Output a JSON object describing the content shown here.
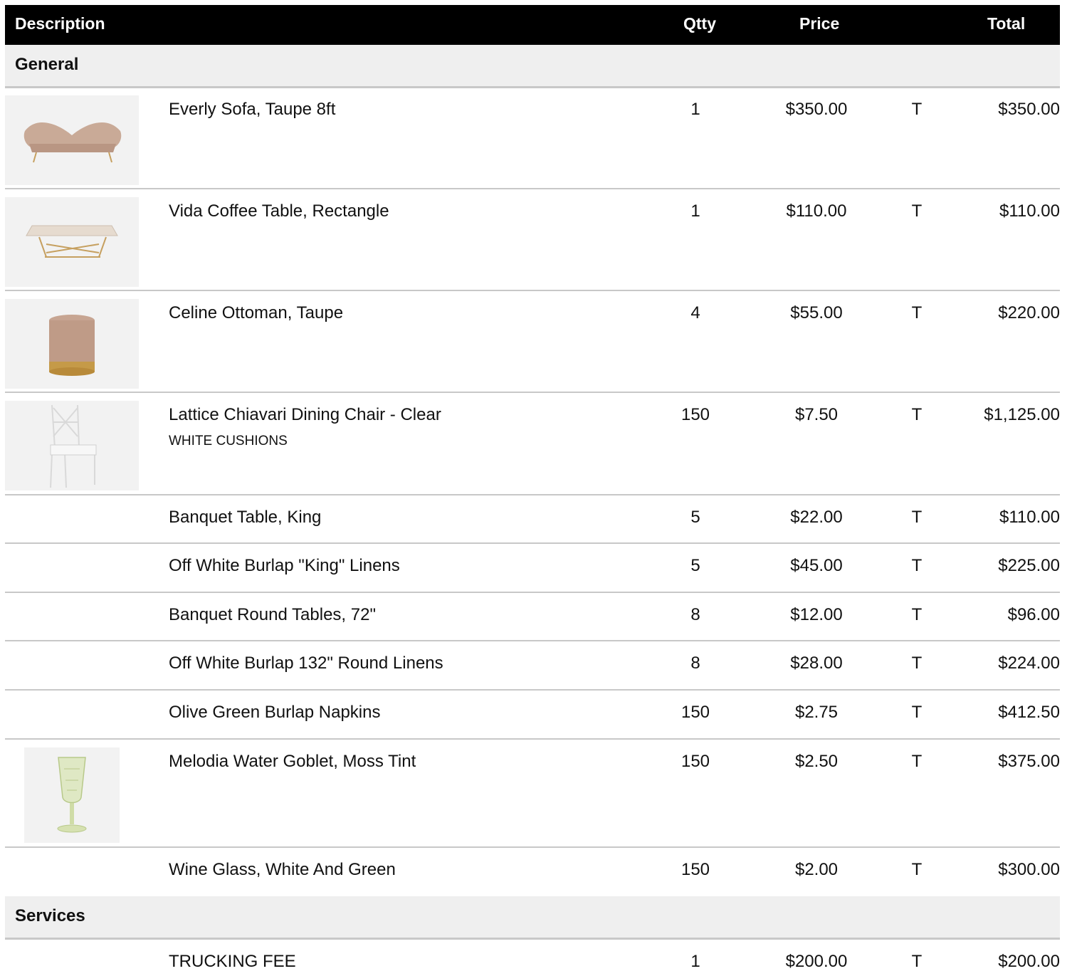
{
  "header": {
    "description": "Description",
    "qty": "Qtty",
    "price": "Price",
    "total": "Total"
  },
  "sections": [
    {
      "title": "General",
      "items": [
        {
          "description": "Everly Sofa, Taupe 8ft",
          "note": "",
          "qty": "1",
          "price": "$350.00",
          "tax": "T",
          "total": "$350.00",
          "image": "sofa"
        },
        {
          "description": "Vida Coffee Table, Rectangle",
          "note": "",
          "qty": "1",
          "price": "$110.00",
          "tax": "T",
          "total": "$110.00",
          "image": "coffee-table"
        },
        {
          "description": "Celine Ottoman, Taupe",
          "note": "",
          "qty": "4",
          "price": "$55.00",
          "tax": "T",
          "total": "$220.00",
          "image": "ottoman"
        },
        {
          "description": "Lattice Chiavari Dining Chair - Clear",
          "note": "WHITE CUSHIONS",
          "qty": "150",
          "price": "$7.50",
          "tax": "T",
          "total": "$1,125.00",
          "image": "chair"
        },
        {
          "description": "Banquet Table, King",
          "note": "",
          "qty": "5",
          "price": "$22.00",
          "tax": "T",
          "total": "$110.00",
          "image": ""
        },
        {
          "description": "Off White Burlap \"King\" Linens",
          "note": "",
          "qty": "5",
          "price": "$45.00",
          "tax": "T",
          "total": "$225.00",
          "image": ""
        },
        {
          "description": "Banquet Round Tables, 72\"",
          "note": "",
          "qty": "8",
          "price": "$12.00",
          "tax": "T",
          "total": "$96.00",
          "image": ""
        },
        {
          "description": "Off White Burlap 132\" Round Linens",
          "note": "",
          "qty": "8",
          "price": "$28.00",
          "tax": "T",
          "total": "$224.00",
          "image": ""
        },
        {
          "description": "Olive Green Burlap Napkins",
          "note": "",
          "qty": "150",
          "price": "$2.75",
          "tax": "T",
          "total": "$412.50",
          "image": ""
        },
        {
          "description": "Melodia Water Goblet, Moss Tint",
          "note": "",
          "qty": "150",
          "price": "$2.50",
          "tax": "T",
          "total": "$375.00",
          "image": "goblet"
        },
        {
          "description": "Wine Glass, White And Green",
          "note": "",
          "qty": "150",
          "price": "$2.00",
          "tax": "T",
          "total": "$300.00",
          "image": ""
        }
      ]
    },
    {
      "title": "Services",
      "items": [
        {
          "description": "TRUCKING FEE",
          "note": "",
          "qty": "1",
          "price": "$200.00",
          "tax": "T",
          "total": "$200.00",
          "image": ""
        }
      ]
    }
  ]
}
